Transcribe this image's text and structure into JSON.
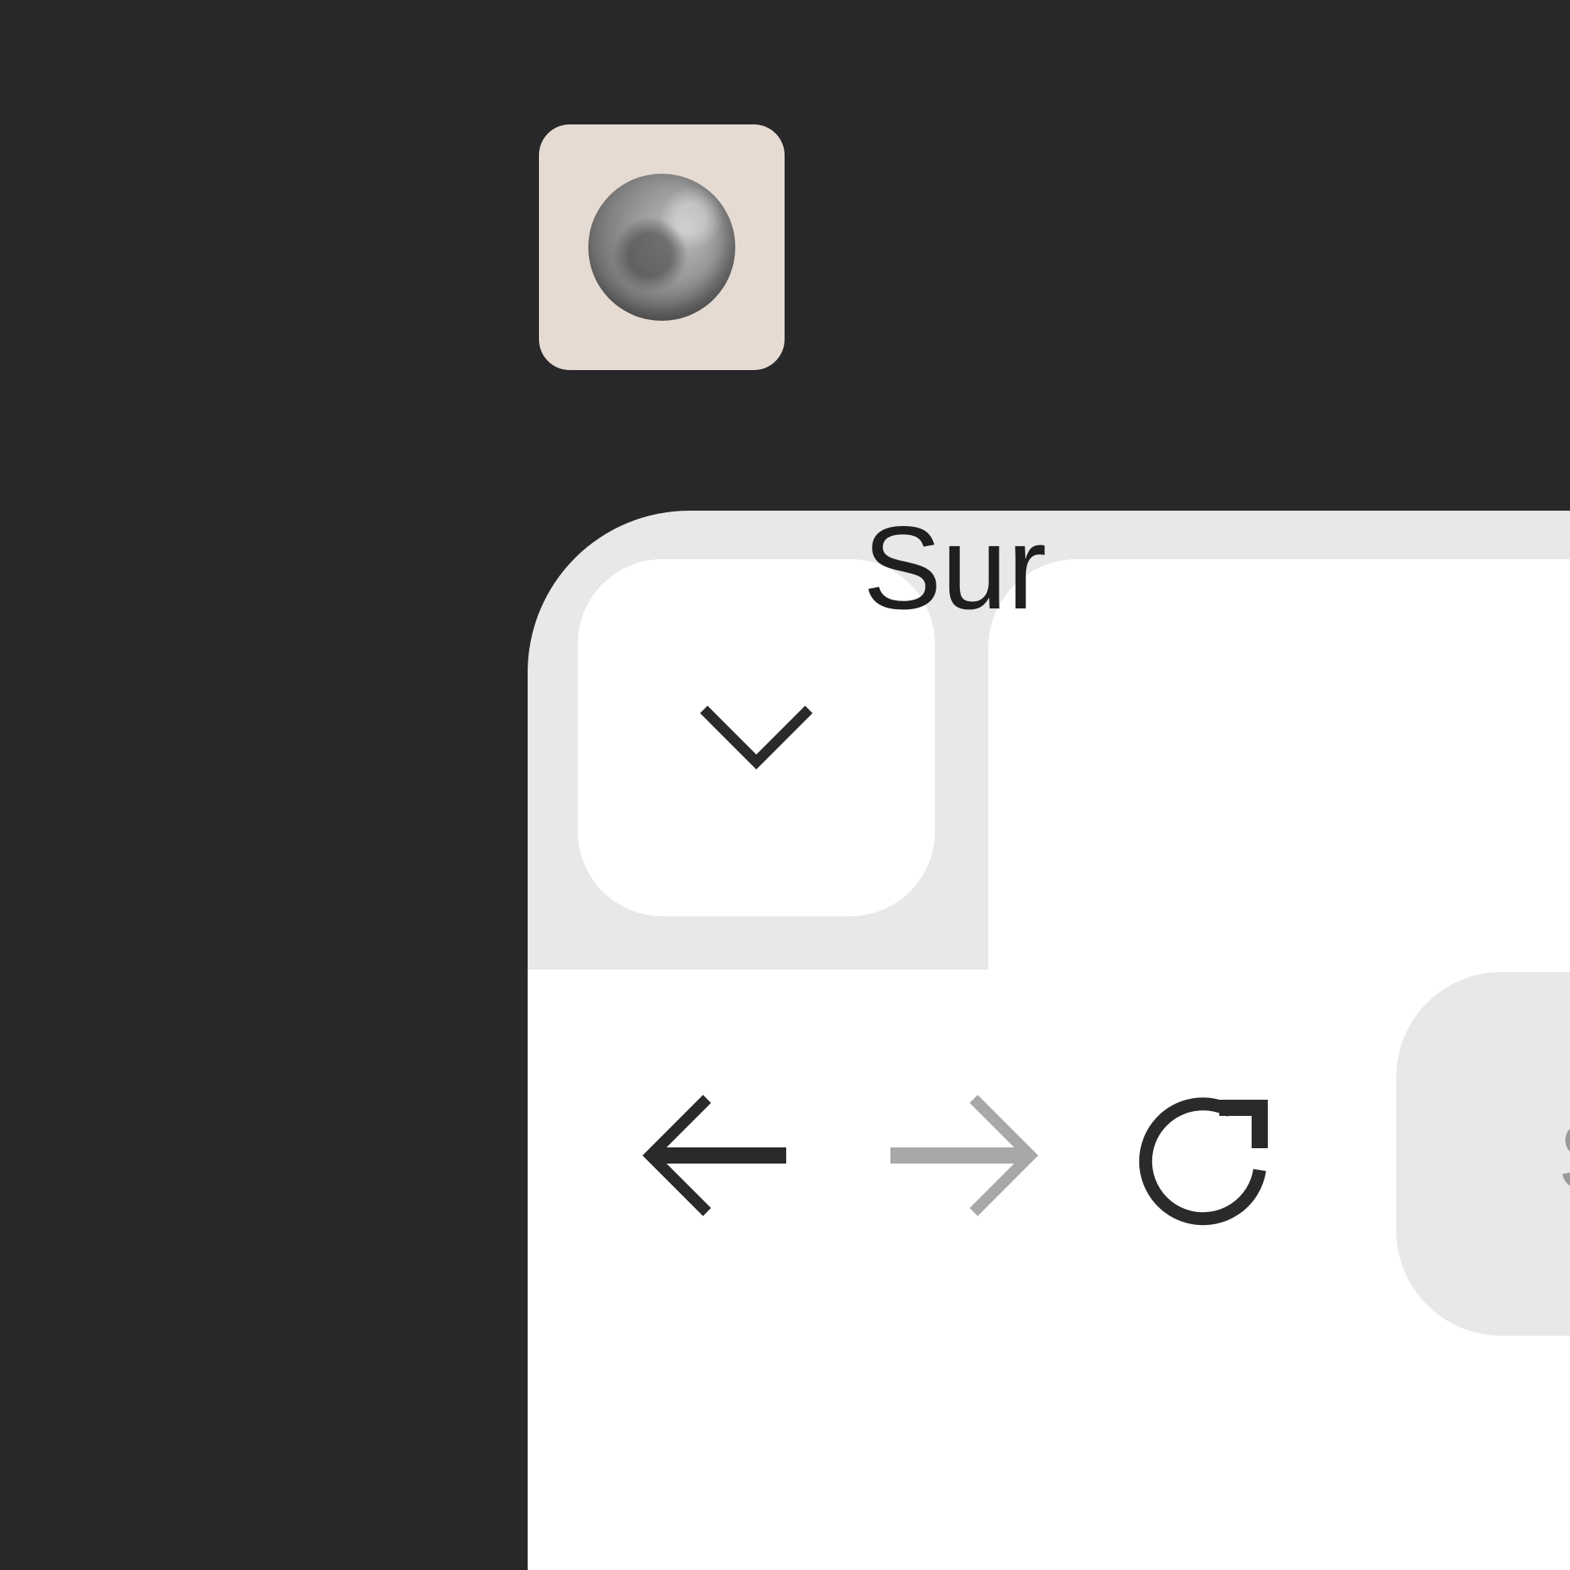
{
  "browser": {
    "tab_menu": {
      "icon": "chevron-down-icon"
    },
    "active_tab": {
      "favicon": "moon-favicon",
      "title": "Sur"
    },
    "navigation": {
      "back_icon": "arrow-left-icon",
      "forward_icon": "arrow-right-icon",
      "forward_enabled": false,
      "reload_icon": "reload-icon"
    },
    "address_bar": {
      "text": "S"
    }
  },
  "colors": {
    "background": "#28282a",
    "chrome": "#e8e8e8",
    "surface": "#ffffff",
    "icon": "#2a2a2c",
    "icon_disabled": "#a8a8a8",
    "favicon_bg": "#e6dbd2"
  }
}
